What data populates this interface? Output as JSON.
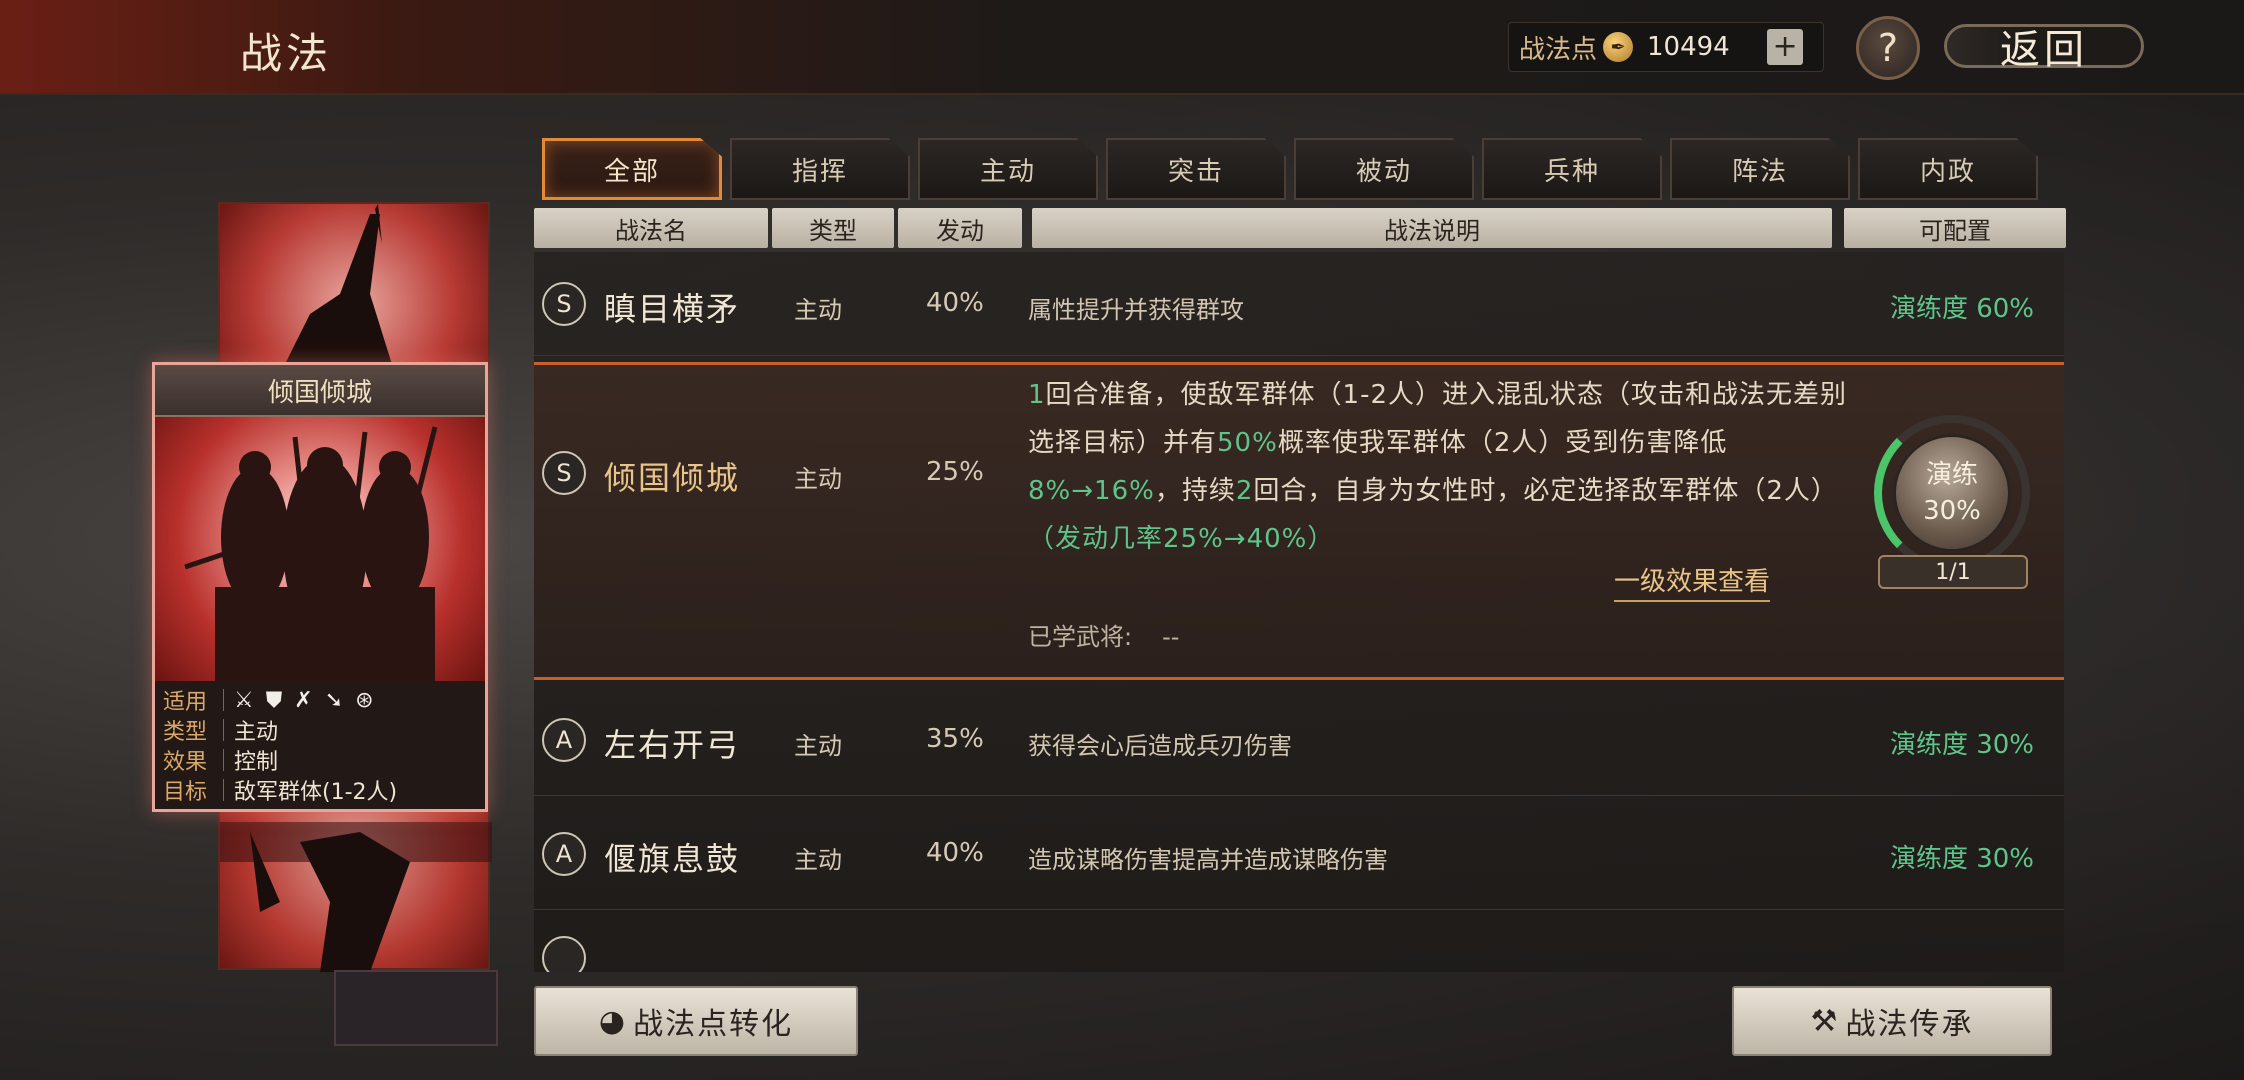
{
  "header": {
    "title": "战法",
    "points_label": "战法点",
    "points_value": "10494",
    "help_label": "?",
    "back_label": "返回"
  },
  "card": {
    "title": "倾国倾城",
    "info": [
      {
        "key": "适用",
        "value": ""
      },
      {
        "key": "类型",
        "value": "主动"
      },
      {
        "key": "效果",
        "value": "控制"
      },
      {
        "key": "目标",
        "value": "敌军群体(1-2人)"
      }
    ],
    "troop_icons": [
      "cavalry-icon",
      "shield-icon",
      "archer-icon",
      "spear-icon",
      "vehicle-icon"
    ]
  },
  "tabs": [
    "全部",
    "指挥",
    "主动",
    "突击",
    "被动",
    "兵种",
    "阵法",
    "内政"
  ],
  "active_tab": "全部",
  "columns": [
    "战法名",
    "类型",
    "发动",
    "战法说明",
    "可配置"
  ],
  "rows": [
    {
      "grade": "S",
      "name": "瞋目横矛",
      "type": "主动",
      "rate": "40%",
      "desc": "属性提升并获得群攻",
      "proficiency": "演练度 60%"
    },
    {
      "grade": "S",
      "name": "倾国倾城",
      "type": "主动",
      "rate": "25%",
      "expanded": true,
      "desc_parts": {
        "p1": "1",
        "p2": "回合准备，使敌军群体（1-2人）进入混乱状态（攻击和战法无差别选择目标）并有",
        "p3": "50%",
        "p4": "概率使我军群体（2人）受到伤害降低",
        "p5": "8%→16%",
        "p6": "，持续",
        "p7": "2",
        "p8": "回合，自身为女性时，必定选择敌军群体（2人）",
        "p9": "（发动几率25%→40%）"
      },
      "detail_link": "一级效果查看",
      "learned_label": "已学武将:",
      "learned_value": "--",
      "practice_label": "演练",
      "practice_value": "30%",
      "practice_count": "1/1"
    },
    {
      "grade": "A",
      "name": "左右开弓",
      "type": "主动",
      "rate": "35%",
      "desc": "获得会心后造成兵刃伤害",
      "proficiency": "演练度 30%"
    },
    {
      "grade": "A",
      "name": "偃旗息鼓",
      "type": "主动",
      "rate": "40%",
      "desc": "造成谋略伤害提高并造成谋略伤害",
      "proficiency": "演练度 30%"
    }
  ],
  "buttons": {
    "convert": "战法点转化",
    "inherit": "战法传承"
  },
  "colors": {
    "accent": "#e08a3a",
    "green": "#5fc48a",
    "gold": "#e8c488"
  }
}
